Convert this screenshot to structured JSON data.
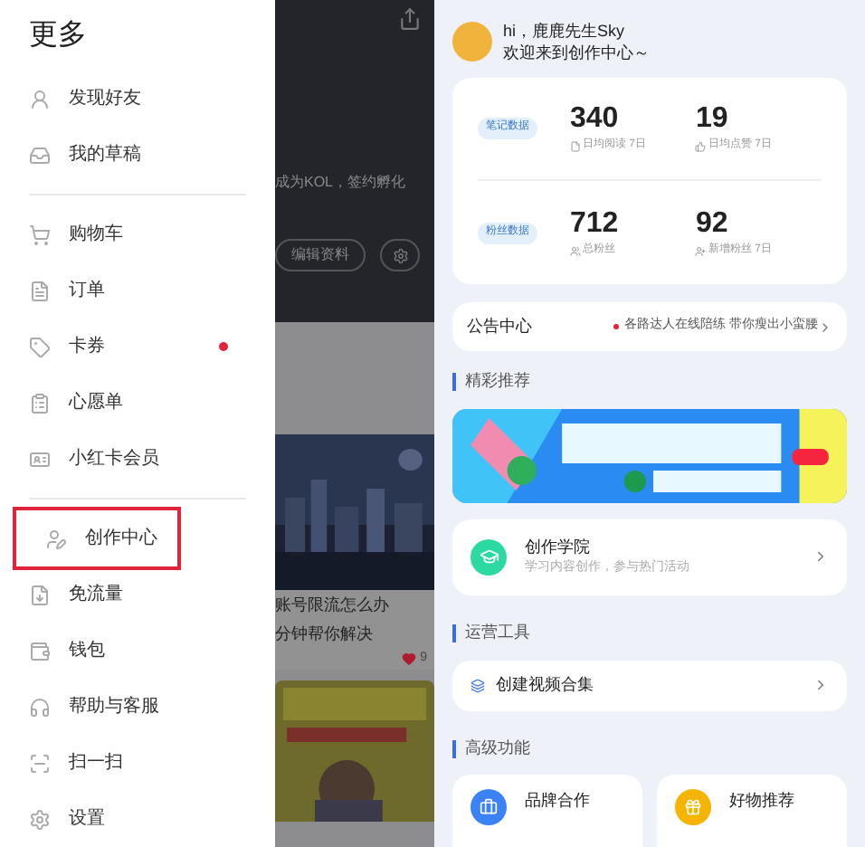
{
  "drawer": {
    "title": "更多",
    "groups": [
      [
        {
          "label": "发现好友",
          "notification": false,
          "highlighted": false
        },
        {
          "label": "我的草稿",
          "notification": false,
          "highlighted": false
        }
      ],
      [
        {
          "label": "购物车",
          "notification": false,
          "highlighted": false
        },
        {
          "label": "订单",
          "notification": false,
          "highlighted": false
        },
        {
          "label": "卡券",
          "notification": true,
          "highlighted": false
        },
        {
          "label": "心愿单",
          "notification": false,
          "highlighted": false
        },
        {
          "label": "小红卡会员",
          "notification": false,
          "highlighted": false
        }
      ],
      [
        {
          "label": "创作中心",
          "notification": false,
          "highlighted": true
        },
        {
          "label": "免流量",
          "notification": false,
          "highlighted": false
        },
        {
          "label": "钱包",
          "notification": false,
          "highlighted": false
        },
        {
          "label": "帮助与客服",
          "notification": false,
          "highlighted": false
        },
        {
          "label": "扫一扫",
          "notification": false,
          "highlighted": false
        },
        {
          "label": "设置",
          "notification": false,
          "highlighted": false
        }
      ]
    ]
  },
  "background_page": {
    "bio": "成为KOL，签约孵化",
    "edit_button": "编辑资料",
    "post": {
      "title_lines": [
        "账号限流怎么办",
        "分钟帮你解决"
      ],
      "likes": "9"
    }
  },
  "creator_center": {
    "greeting": "hi，鹿鹿先生Sky",
    "welcome": "欢迎来到创作中心～",
    "stats": [
      {
        "tag": "笔记数据",
        "metrics": [
          {
            "value": "340",
            "label": "日均阅读 7日"
          },
          {
            "value": "19",
            "label": "日均点赞 7日"
          }
        ]
      },
      {
        "tag": "粉丝数据",
        "metrics": [
          {
            "value": "712",
            "label": "总粉丝"
          },
          {
            "value": "92",
            "label": "新增粉丝 7日"
          }
        ]
      }
    ],
    "announcement": {
      "title": "公告中心",
      "text": "各路达人在线陪练 带你瘦出小蛮腰"
    },
    "recommend_heading": "精彩推荐",
    "academy": {
      "title": "创作学院",
      "subtitle": "学习内容创作，参与热门活动"
    },
    "tools_heading": "运营工具",
    "tools": [
      {
        "label": "创建视频合集"
      }
    ],
    "advanced_heading": "高级功能",
    "features": [
      {
        "title": "品牌合作"
      },
      {
        "title": "好物推荐"
      }
    ]
  }
}
